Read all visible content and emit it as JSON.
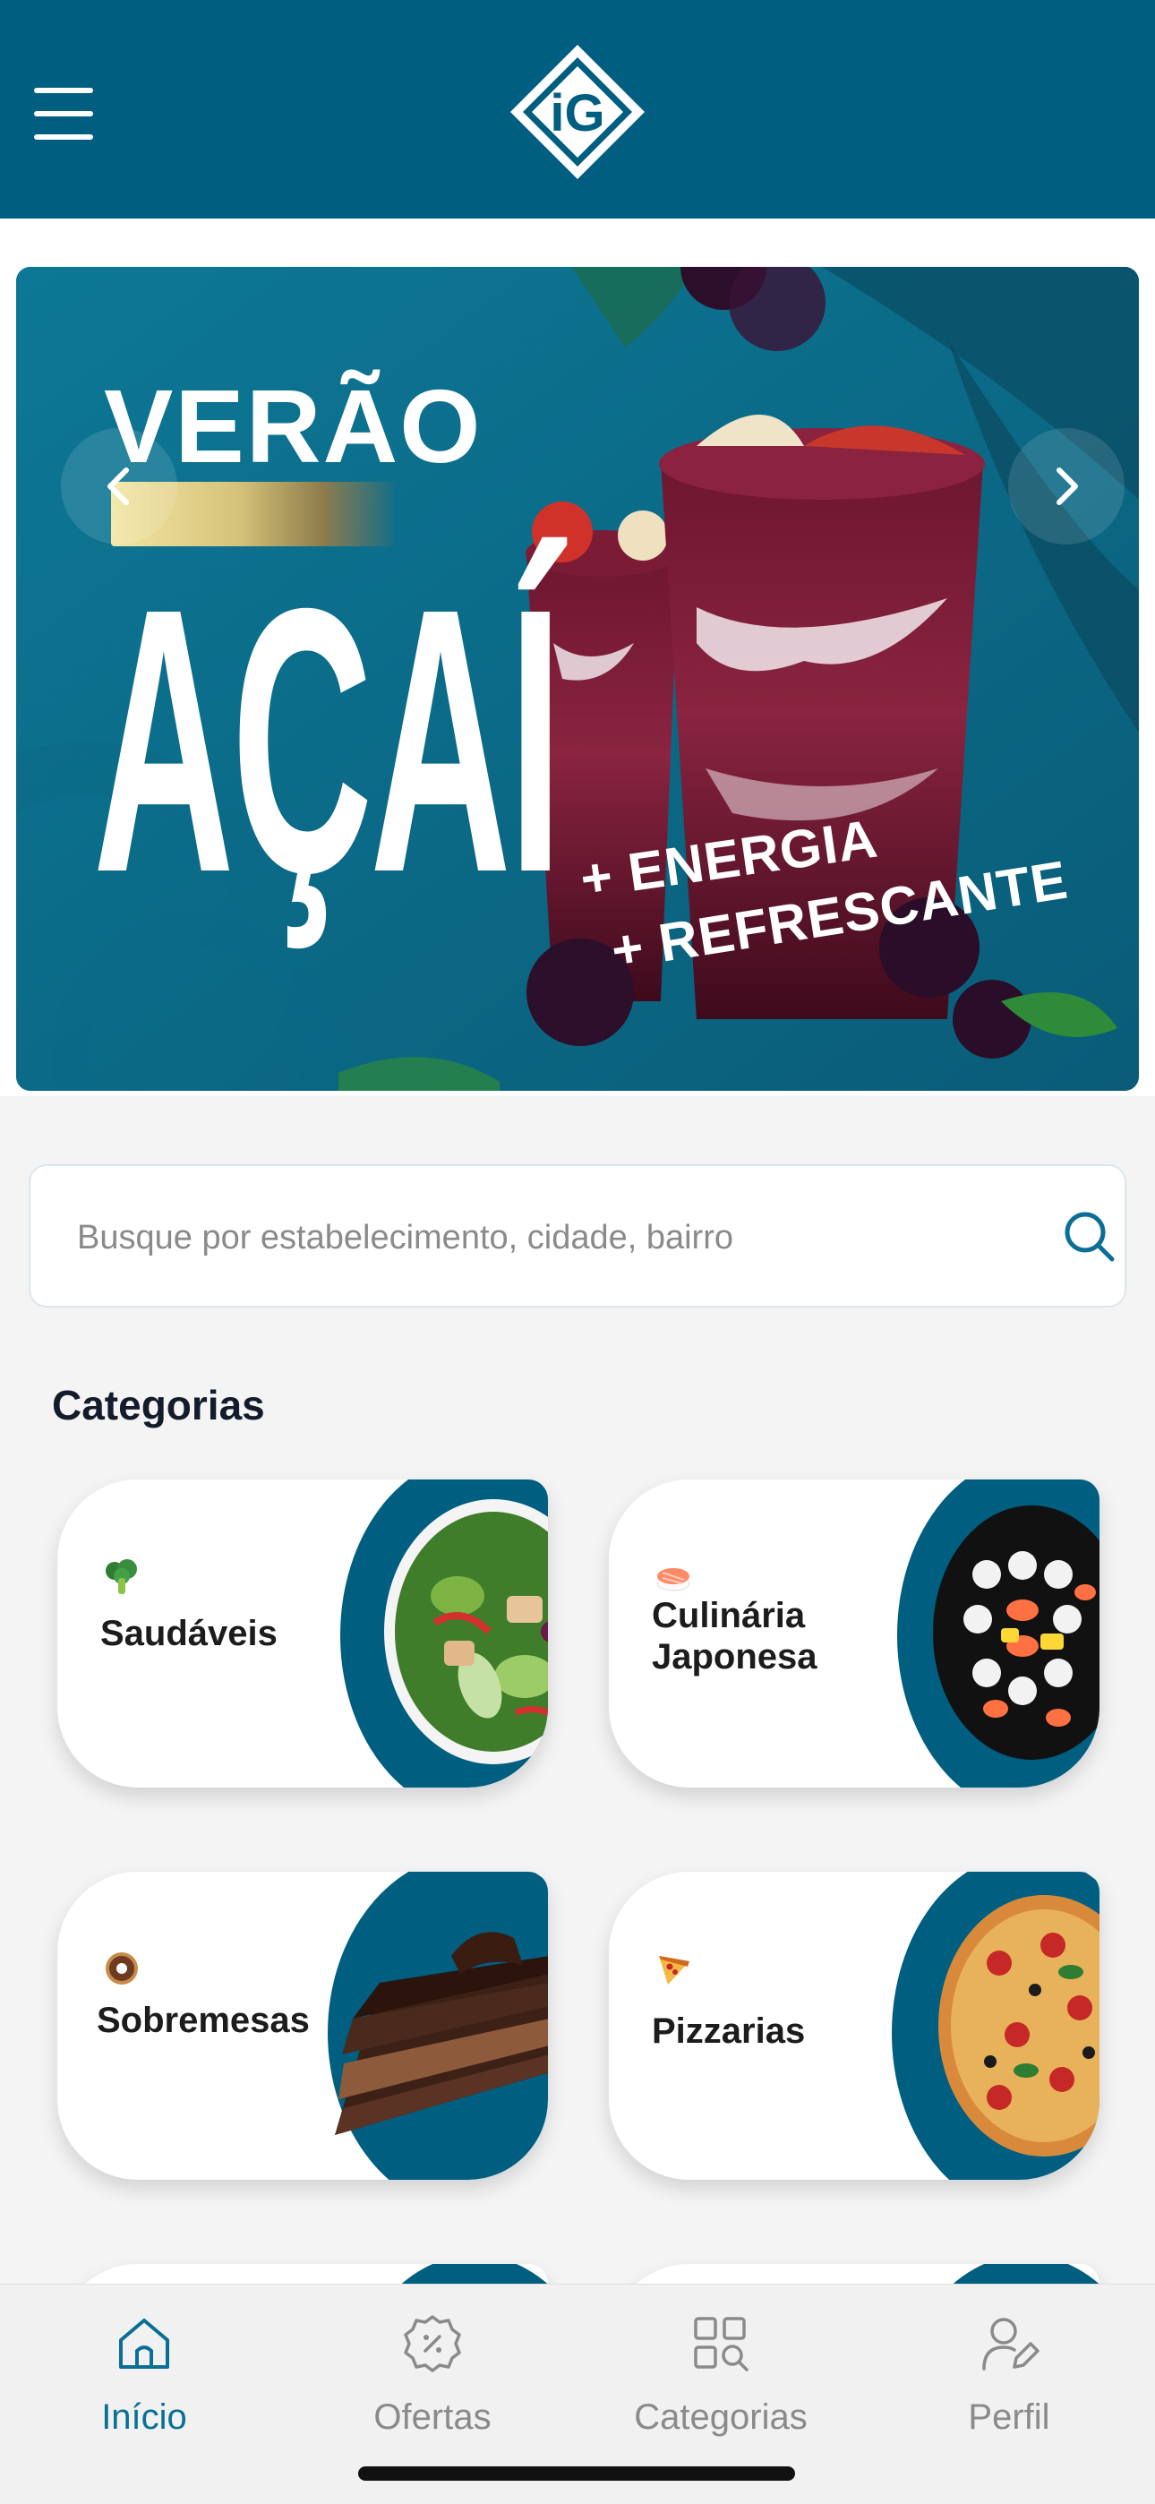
{
  "header": {
    "menu_icon": "menu-icon",
    "logo_icon": "brand-logo-icon",
    "colors": {
      "background": "#005e80",
      "accent": "#0a6f95"
    }
  },
  "banner": {
    "title_top": "VERÃO",
    "title_main": "AÇAÍ",
    "tagline_1": "+ ENERGIA",
    "tagline_2": "+ REFRESCANTE",
    "prev_icon": "chevron-left-icon",
    "next_icon": "chevron-right-icon"
  },
  "search": {
    "placeholder": "Busque por estabelecimento, cidade, bairro",
    "value": "",
    "icon": "search-icon"
  },
  "categories": {
    "title": "Categorias",
    "items": [
      {
        "label_1": "Saudáveis",
        "label_2": "",
        "icon": "broccoli-icon"
      },
      {
        "label_1": "Culinária",
        "label_2": "Japonesa",
        "icon": "sushi-icon"
      },
      {
        "label_1": "Sobremesas",
        "label_2": "",
        "icon": "donut-icon"
      },
      {
        "label_1": "Pizzarias",
        "label_2": "",
        "icon": "pizza-slice-icon"
      }
    ]
  },
  "bottom_nav": {
    "items": [
      {
        "label": "Início",
        "icon": "home-icon",
        "active": true
      },
      {
        "label": "Ofertas",
        "icon": "discount-badge-icon",
        "active": false
      },
      {
        "label": "Categorias",
        "icon": "category-search-icon",
        "active": false
      },
      {
        "label": "Perfil",
        "icon": "user-edit-icon",
        "active": false
      }
    ]
  }
}
